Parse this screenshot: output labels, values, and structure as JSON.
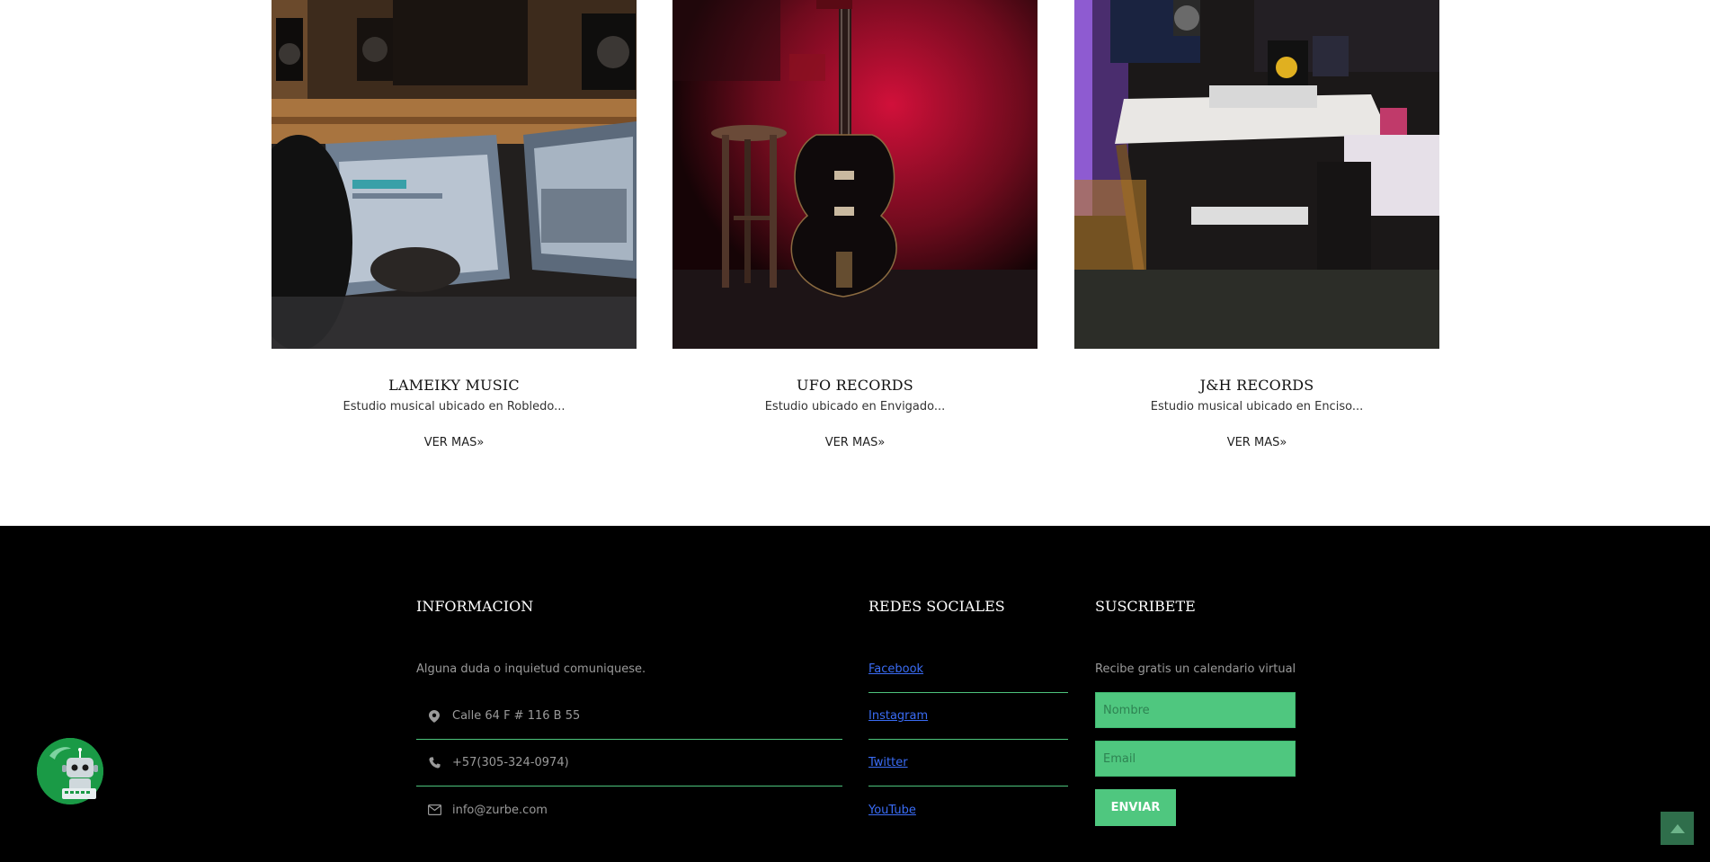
{
  "studios": [
    {
      "name": "LAMEIKY MUSIC",
      "description": "Estudio musical ubicado en Robledo...",
      "link": "VER MAS»"
    },
    {
      "name": "UFO RECORDS",
      "description": "Estudio ubicado en Envigado...",
      "link": "VER MAS»"
    },
    {
      "name": "J&H RECORDS",
      "description": "Estudio musical ubicado en Enciso...",
      "link": "VER MAS»"
    }
  ],
  "footer": {
    "info": {
      "title": "INFORMACION",
      "text": "Alguna duda o inquietud comuniquese.",
      "address": "Calle 64 F # 116 B 55",
      "phone": "+57(305-324-0974)",
      "email": "info@zurbe.com"
    },
    "social": {
      "title": "REDES SOCIALES",
      "links": [
        "Facebook",
        "Instagram",
        "Twitter",
        "YouTube"
      ]
    },
    "subscribe": {
      "title": "SUSCRIBETE",
      "text": "Recibe gratis un calendario virtual",
      "name_placeholder": "Nombre",
      "email_placeholder": "Email",
      "button": "ENVIAR"
    }
  },
  "colors": {
    "accent": "#4fc77f",
    "footer_bg": "#000000",
    "link": "#3a6cf5"
  }
}
